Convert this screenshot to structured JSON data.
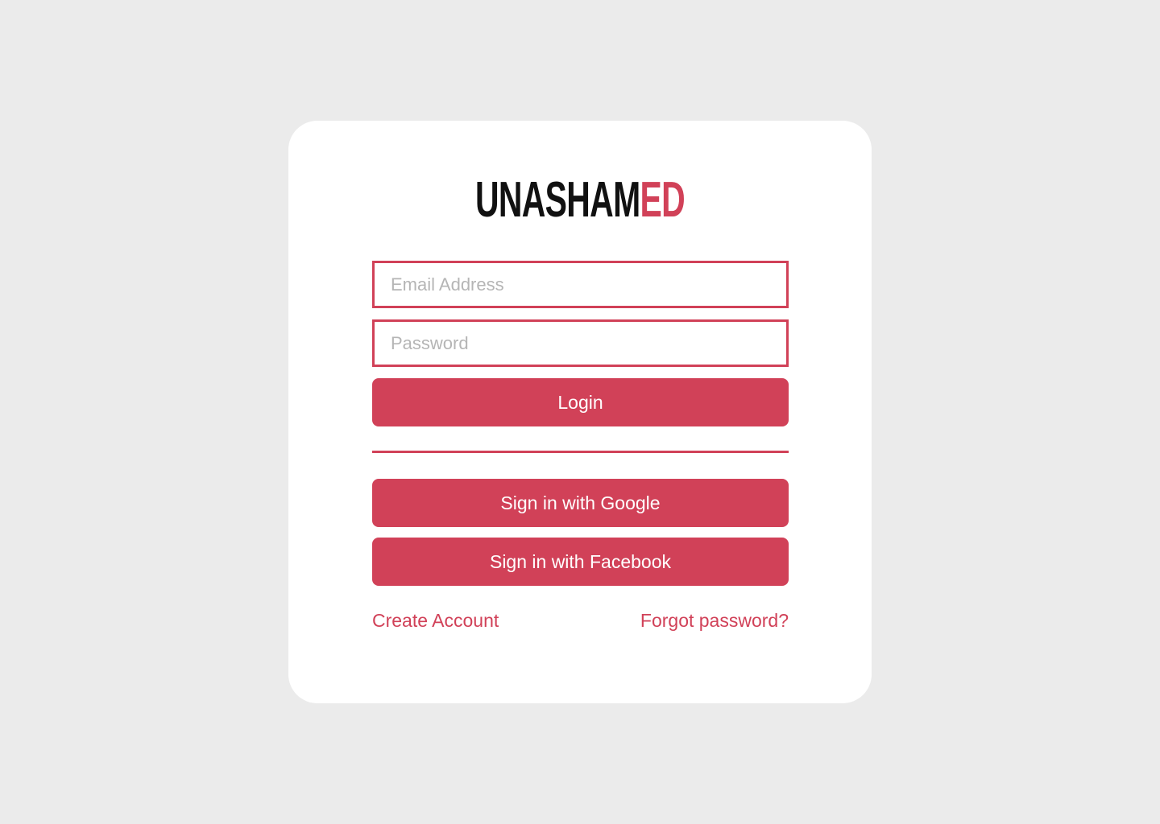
{
  "logo": {
    "part_dark": "UNASHAM",
    "part_accent": "ED"
  },
  "form": {
    "email_placeholder": "Email Address",
    "password_placeholder": "Password",
    "login_label": "Login",
    "google_label": "Sign in with Google",
    "facebook_label": "Sign in with Facebook"
  },
  "links": {
    "create_account": "Create Account",
    "forgot_password": "Forgot password?"
  },
  "colors": {
    "accent": "#D14158",
    "background": "#EBEBEB",
    "card": "#FFFFFF",
    "logo_dark": "#111111",
    "placeholder": "#B5B5B5"
  }
}
